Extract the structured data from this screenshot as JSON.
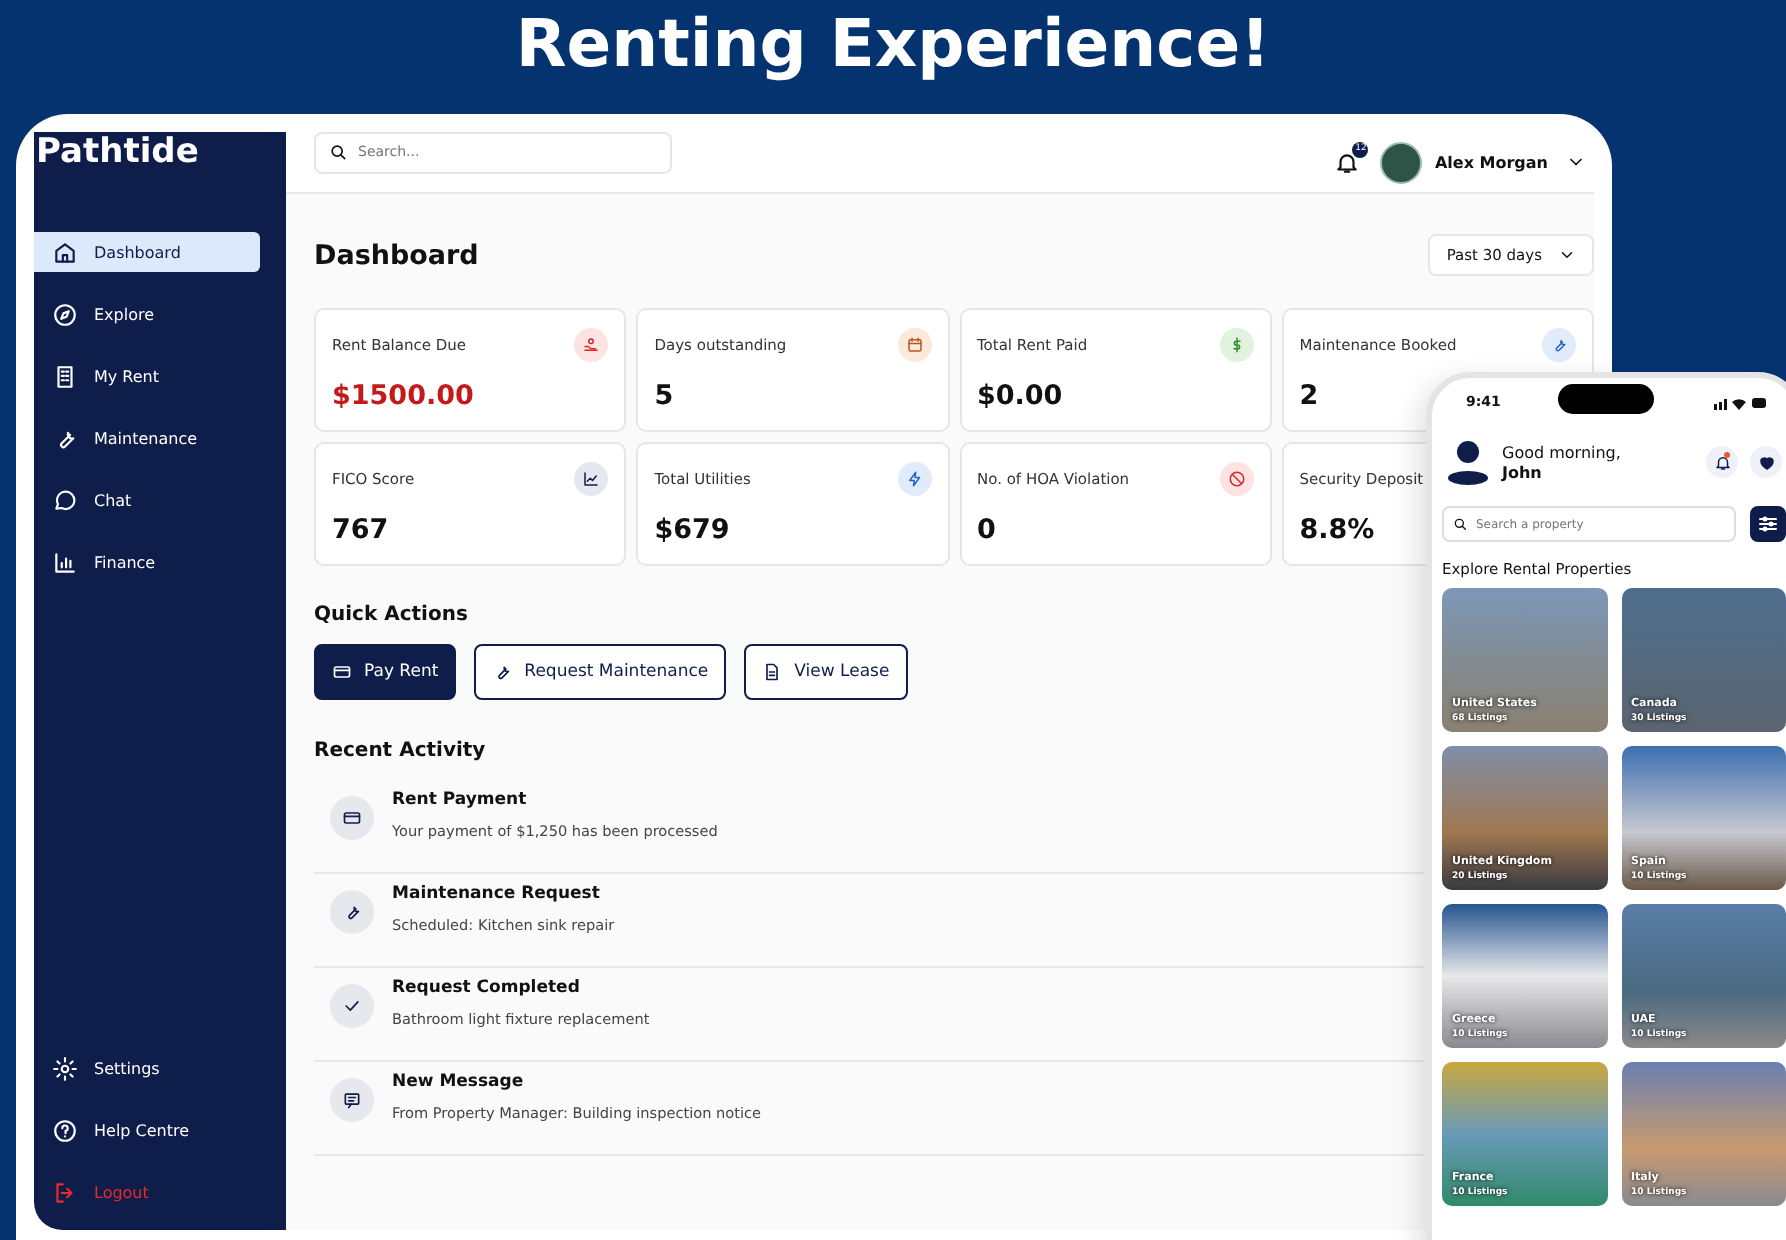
{
  "headline": "Renting Experience!",
  "app": {
    "logo": "Pathtide",
    "sidebar": {
      "items": [
        {
          "label": "Dashboard",
          "selected": true,
          "kind": "nav"
        },
        {
          "label": "Explore",
          "selected": false,
          "kind": "nav"
        },
        {
          "label": "My Rent",
          "selected": false,
          "kind": "nav"
        },
        {
          "label": "Maintenance",
          "selected": false,
          "kind": "nav"
        },
        {
          "label": "Chat",
          "selected": false,
          "kind": "nav"
        },
        {
          "label": "Finance",
          "selected": false,
          "kind": "nav"
        }
      ],
      "bottom_items": [
        {
          "label": "Settings",
          "selected": false,
          "kind": "nav"
        },
        {
          "label": "Help Centre",
          "selected": false,
          "kind": "nav"
        },
        {
          "label": "Logout",
          "selected": false,
          "kind": "logout"
        }
      ]
    },
    "topbar": {
      "search": {
        "placeholder": "Search..."
      },
      "notification_count": "12",
      "user_name": "Alex Morgan"
    },
    "page_title": "Dashboard",
    "period": "Past 30 days",
    "stats": [
      {
        "label": "Rent Balance Due",
        "value": "$1500.00",
        "overdue": true
      },
      {
        "label": "Days outstanding",
        "value": "5",
        "overdue": false
      },
      {
        "label": "Total Rent Paid",
        "value": "$0.00",
        "overdue": false
      },
      {
        "label": "Maintenance Booked",
        "value": "2",
        "overdue": false
      },
      {
        "label": "FICO Score",
        "value": "767",
        "overdue": false
      },
      {
        "label": "Total  Utilities",
        "value": "$679",
        "overdue": false
      },
      {
        "label": "No. of HOA Violation",
        "value": "0",
        "overdue": false
      },
      {
        "label": "Security Deposit",
        "value": "8.8%",
        "overdue": false
      }
    ],
    "quick_actions": {
      "title": "Quick Actions",
      "buttons": [
        {
          "label": "Pay Rent",
          "kind": "primary"
        },
        {
          "label": "Request Maintenance",
          "kind": "outline"
        },
        {
          "label": "View Lease",
          "kind": "outline"
        }
      ]
    },
    "recent_activity": {
      "title": "Recent Activity",
      "items": [
        {
          "title": "Rent Payment",
          "detail": "Your payment of $1,250 has been processed"
        },
        {
          "title": "Maintenance Request",
          "detail": "Scheduled: Kitchen sink repair"
        },
        {
          "title": "Request Completed",
          "detail": "Bathroom light fixture replacement"
        },
        {
          "title": "New Message",
          "detail": "From Property Manager: Building inspection notice"
        }
      ]
    }
  },
  "phone": {
    "time": "9:41",
    "greeting": "Good morning,",
    "name": "John",
    "search": {
      "placeholder": "Search a property"
    },
    "section_title": "Explore Rental Properties",
    "properties": [
      {
        "country": "United States",
        "listings": "68 Listings"
      },
      {
        "country": "Canada",
        "listings": "30 Listings"
      },
      {
        "country": "United Kingdom",
        "listings": "20 Listings"
      },
      {
        "country": "Spain",
        "listings": "10 Listings"
      },
      {
        "country": "Greece",
        "listings": "10 Listings"
      },
      {
        "country": "UAE",
        "listings": "10 Listings"
      },
      {
        "country": "France",
        "listings": "10 Listings"
      },
      {
        "country": "Italy",
        "listings": "10 Listings"
      }
    ]
  }
}
